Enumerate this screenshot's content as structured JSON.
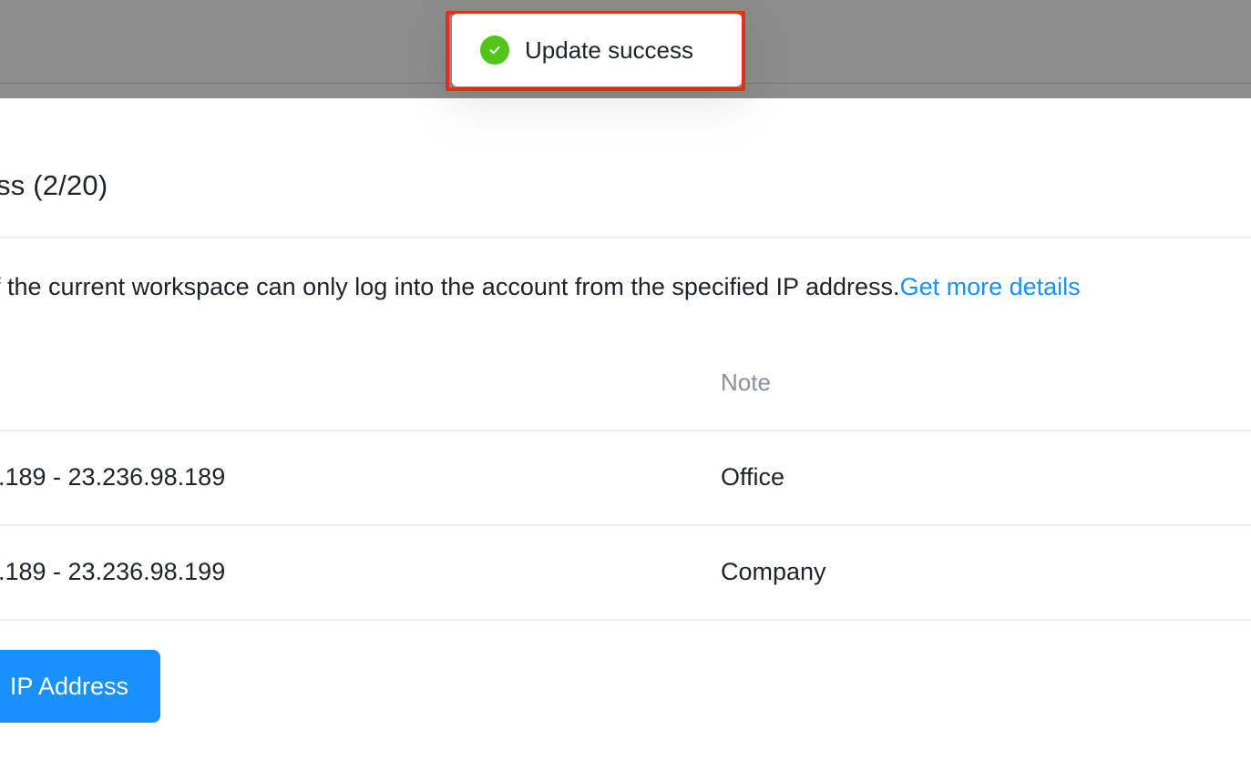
{
  "toast": {
    "icon": "check-circle-icon",
    "message": "Update success",
    "colors": {
      "success": "#52c41a",
      "highlight": "#e8311a"
    }
  },
  "section": {
    "title": "ss (2/20)"
  },
  "description": {
    "text": "of the current workspace can only log into the account from the specified IP address.",
    "link_label": "Get more details"
  },
  "table": {
    "columns": {
      "note": "Note"
    },
    "rows": [
      {
        "ip_range": ".189 - 23.236.98.189",
        "note": "Office"
      },
      {
        "ip_range": ".189 - 23.236.98.199",
        "note": "Company"
      }
    ]
  },
  "actions": {
    "add_label": "IP Address"
  },
  "theme": {
    "accent": "#1890ff",
    "mask": "#8c8c8c"
  }
}
